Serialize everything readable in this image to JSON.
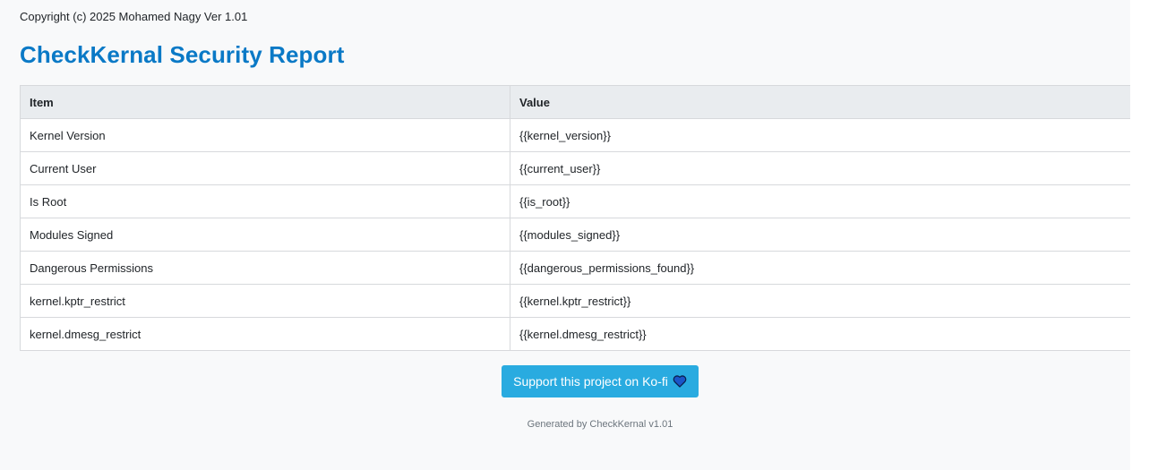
{
  "header": {
    "copyright": "Copyright (c) 2025 Mohamed Nagy Ver 1.01",
    "title": "CheckKernal Security Report"
  },
  "table": {
    "columns": [
      "Item",
      "Value"
    ],
    "rows": [
      {
        "item": "Kernel Version",
        "value": "{{kernel_version}}"
      },
      {
        "item": "Current User",
        "value": "{{current_user}}"
      },
      {
        "item": "Is Root",
        "value": "{{is_root}}"
      },
      {
        "item": "Modules Signed",
        "value": "{{modules_signed}}"
      },
      {
        "item": "Dangerous Permissions",
        "value": "{{dangerous_permissions_found}}"
      },
      {
        "item": "kernel.kptr_restrict",
        "value": "{{kernel.kptr_restrict}}"
      },
      {
        "item": "kernel.dmesg_restrict",
        "value": "{{kernel.dmesg_restrict}}"
      }
    ]
  },
  "support": {
    "label": "Support this project on Ko-fi",
    "icon": "heart-icon"
  },
  "footer": {
    "text": "Generated by CheckKernal v1.01"
  },
  "colors": {
    "title": "#0a79c6",
    "button": "#29abe0",
    "heart_fill": "#1a56c8",
    "page_background": "#f8f9fa",
    "table_header": "#e9ecef"
  }
}
